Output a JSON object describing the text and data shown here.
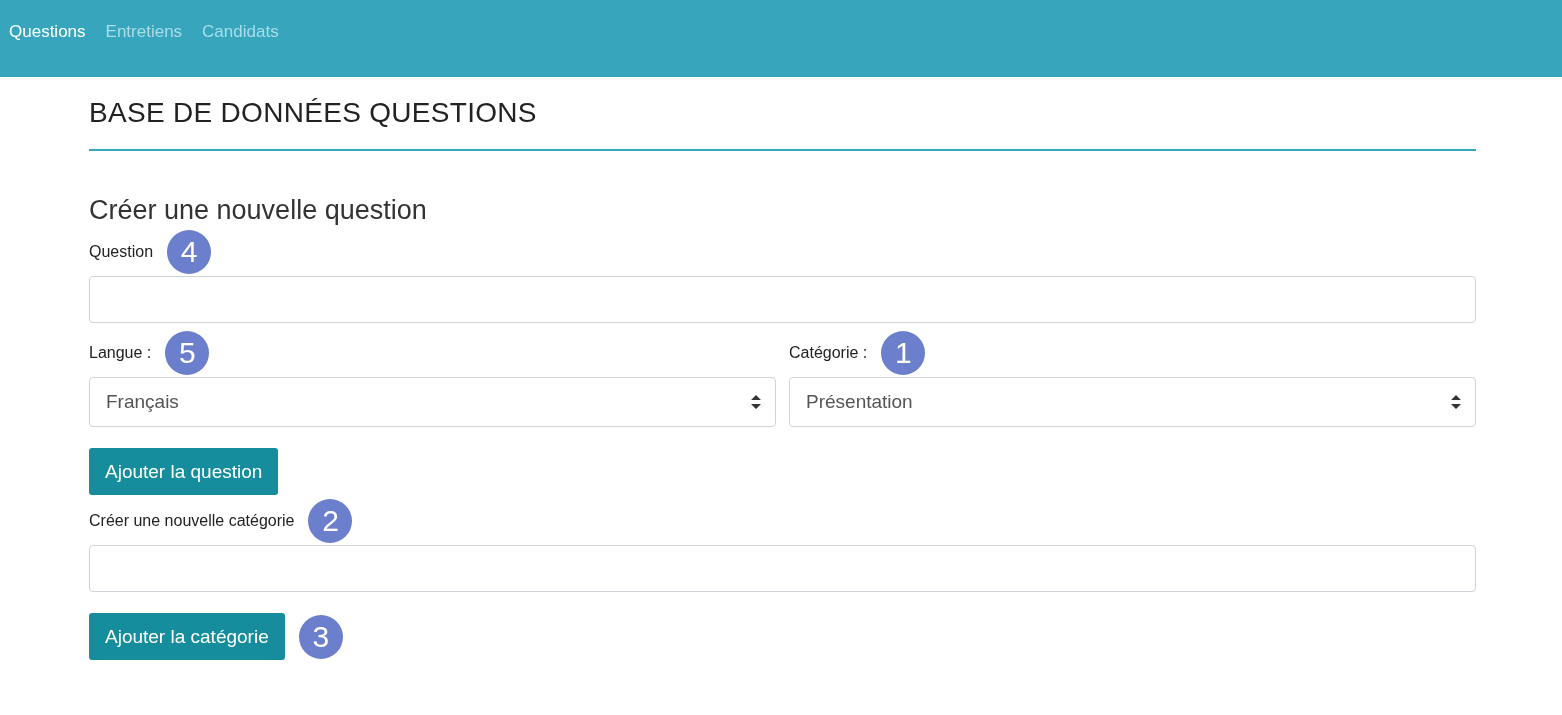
{
  "nav": {
    "items": [
      {
        "label": "Questions",
        "selected": true
      },
      {
        "label": "Entretiens",
        "selected": false
      },
      {
        "label": "Candidats",
        "selected": false
      }
    ]
  },
  "page_title": "BASE DE DONNÉES QUESTIONS",
  "form_title": "Créer une nouvelle question",
  "question_field": {
    "label": "Question",
    "badge": "4"
  },
  "selects": [
    {
      "label": "Langue :",
      "badge": "5",
      "value": "Français"
    },
    {
      "label": "Catégorie :",
      "badge": "1",
      "value": "Présentation"
    }
  ],
  "add_question_button": {
    "label": "Ajouter la question"
  },
  "category_field": {
    "label": "Créer une nouvelle catégorie",
    "badge": "2"
  },
  "add_category_button": {
    "label": "Ajouter la catégorie",
    "badge": "3"
  }
}
